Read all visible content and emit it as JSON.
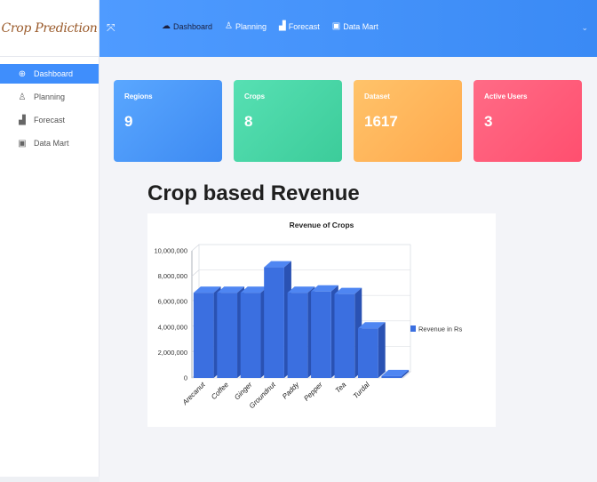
{
  "app": {
    "brand": "Crop Prediction"
  },
  "sidebar": {
    "items": [
      {
        "label": "Dashboard",
        "icon": "dashboard-icon",
        "active": true
      },
      {
        "label": "Planning",
        "icon": "user-icon",
        "active": false
      },
      {
        "label": "Forecast",
        "icon": "bar-chart-icon",
        "active": false
      },
      {
        "label": "Data Mart",
        "icon": "database-icon",
        "active": false
      }
    ]
  },
  "topbar": {
    "nav": [
      {
        "label": "Dashboard",
        "icon": "dashboard-icon"
      },
      {
        "label": "Planning",
        "icon": "user-icon"
      },
      {
        "label": "Forecast",
        "icon": "bar-chart-icon"
      },
      {
        "label": "Data Mart",
        "icon": "database-icon"
      }
    ]
  },
  "cards": [
    {
      "label": "Regions",
      "value": "9"
    },
    {
      "label": "Crops",
      "value": "8"
    },
    {
      "label": "Dataset",
      "value": "1617"
    },
    {
      "label": "Active Users",
      "value": "3"
    }
  ],
  "section": {
    "title": "Crop based Revenue"
  },
  "colors": {
    "accent": "#3f8efc",
    "bar": "#3b6fe0",
    "bar_top": "#4f86f2",
    "bar_side": "#2a52b3"
  },
  "chart_data": {
    "type": "bar",
    "title": "Revenue of Crops",
    "categories": [
      "Arecanut",
      "Coffee",
      "Ginger",
      "Groundnut",
      "Paddy",
      "Pepper",
      "Tea",
      "Turdal"
    ],
    "series": [
      {
        "name": "Revenue in Rs",
        "values": [
          6700000,
          6700000,
          6700000,
          8700000,
          6700000,
          6800000,
          6600000,
          3900000,
          150000
        ]
      }
    ],
    "yticks": [
      "0",
      "2,000,000",
      "4,000,000",
      "6,000,000",
      "8,000,000",
      "10,000,000"
    ],
    "ylim": [
      0,
      10000000
    ],
    "grid": true,
    "legend_position": "right"
  }
}
